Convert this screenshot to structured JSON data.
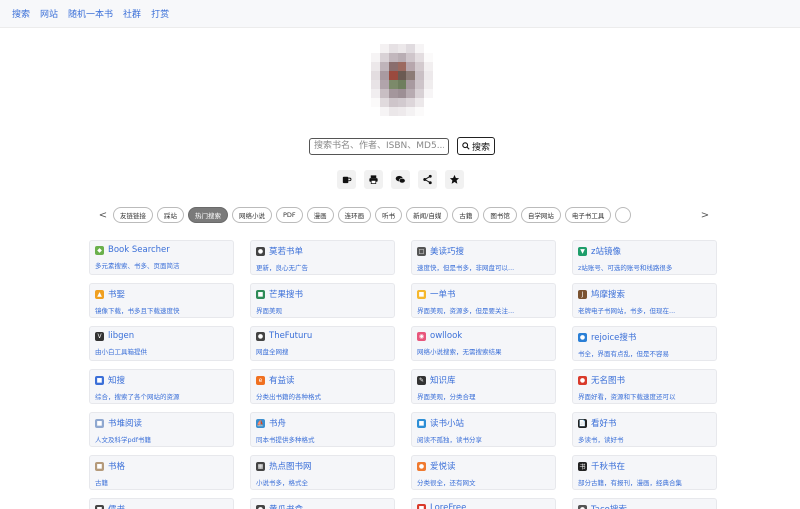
{
  "nav": [
    "搜索",
    "网站",
    "随机一本书",
    "社群",
    "打赏"
  ],
  "search": {
    "placeholder": "搜索书名、作者、ISBN、MD5...",
    "button_label": "搜索"
  },
  "share_icons": [
    "mug-icon",
    "printer-icon",
    "wechat-icon",
    "share-icon",
    "star-icon"
  ],
  "tabs": {
    "prev": "<",
    "next": ">",
    "items": [
      "友链链接",
      "踩站",
      "热门搜索",
      "网络小说",
      "PDF",
      "漫画",
      "连环画",
      "听书",
      "新闻/自媒",
      "古籍",
      "图书馆",
      "自学网站",
      "电子书工具",
      ""
    ],
    "active_index": 2
  },
  "cards": [
    {
      "title": "Book Searcher",
      "desc": "多元素搜索、书多、页面简洁",
      "icon_color": "#6ab04c",
      "icon_glyph": "◆"
    },
    {
      "title": "莫若书单",
      "desc": "更新，良心无广告",
      "icon_color": "#444444",
      "icon_glyph": "●"
    },
    {
      "title": "美读巧搜",
      "desc": "速度快，但是书多，非网盘可以...",
      "icon_color": "#555555",
      "icon_glyph": "□"
    },
    {
      "title": "z站镜像",
      "desc": "z站账号、可选的账号和线路很多",
      "icon_color": "#1e9e6a",
      "icon_glyph": "▼"
    },
    {
      "title": "书娶",
      "desc": "镜像下载，书多且下载速度快",
      "icon_color": "#f0a020",
      "icon_glyph": "▲"
    },
    {
      "title": "芒果搜书",
      "desc": "界面美观",
      "icon_color": "#2e8b57",
      "icon_glyph": "■"
    },
    {
      "title": "一单书",
      "desc": "界面美观，资源多，但是要关注...",
      "icon_color": "#f5b82e",
      "icon_glyph": "■"
    },
    {
      "title": "鸠摩搜索",
      "desc": "老牌电子书网站，书多，但现在...",
      "icon_color": "#7a5230",
      "icon_glyph": "J"
    },
    {
      "title": "libgen",
      "desc": "由小白工具箱提供",
      "icon_color": "#333333",
      "icon_glyph": "V"
    },
    {
      "title": "TheFuturu",
      "desc": "网盘全网搜",
      "icon_color": "#444444",
      "icon_glyph": "●"
    },
    {
      "title": "owllook",
      "desc": "网络小说搜索，无需搜索结果",
      "icon_color": "#e8567c",
      "icon_glyph": "◉"
    },
    {
      "title": "rejoice搜书",
      "desc": "书全，界面有点乱，但是不容易",
      "icon_color": "#2a7fd6",
      "icon_glyph": "●"
    },
    {
      "title": "知搜",
      "desc": "综合，搜索了各个网站的资源",
      "icon_color": "#3b6fd8",
      "icon_glyph": "■"
    },
    {
      "title": "有益读",
      "desc": "分类出书籍的各种格式",
      "icon_color": "#f07020",
      "icon_glyph": "e"
    },
    {
      "title": "知识库",
      "desc": "界面美观，分类合理",
      "icon_color": "#333333",
      "icon_glyph": "✎"
    },
    {
      "title": "无名图书",
      "desc": "界面好看，资源和下载速度还可以",
      "icon_color": "#d93a2b",
      "icon_glyph": "●"
    },
    {
      "title": "书堆阅读",
      "desc": "人文及科学pdf书籍",
      "icon_color": "#8fa8d0",
      "icon_glyph": "■"
    },
    {
      "title": "书舟",
      "desc": "同本书提供多种格式",
      "icon_color": "#3a8fd0",
      "icon_glyph": "⛵"
    },
    {
      "title": "读书小站",
      "desc": "阅读不孤独，读书分享",
      "icon_color": "#2e8fd6",
      "icon_glyph": "■"
    },
    {
      "title": "看好书",
      "desc": "多读书，读好书",
      "icon_color": "#222222",
      "icon_glyph": "📄"
    },
    {
      "title": "书格",
      "desc": "古籍",
      "icon_color": "#b59a7a",
      "icon_glyph": "■"
    },
    {
      "title": "热点图书网",
      "desc": "小说书多，格式全",
      "icon_color": "#444444",
      "icon_glyph": "▦"
    },
    {
      "title": "爱悦读",
      "desc": "分类很全，还有网文",
      "icon_color": "#f07a30",
      "icon_glyph": "●"
    },
    {
      "title": "千秋书在",
      "desc": "部分古籍，有报刊，漫画，经典合集",
      "icon_color": "#222222",
      "icon_glyph": "书"
    },
    {
      "title": "儒书",
      "desc": "",
      "icon_color": "#444444",
      "icon_glyph": "■"
    },
    {
      "title": "黄瓜书盒",
      "desc": "",
      "icon_color": "#444444",
      "icon_glyph": "●"
    },
    {
      "title": "LoreFree",
      "desc": "",
      "icon_color": "#d93a2b",
      "icon_glyph": "■"
    },
    {
      "title": "Taco搜索",
      "desc": "",
      "icon_color": "#555555",
      "icon_glyph": "●"
    }
  ]
}
